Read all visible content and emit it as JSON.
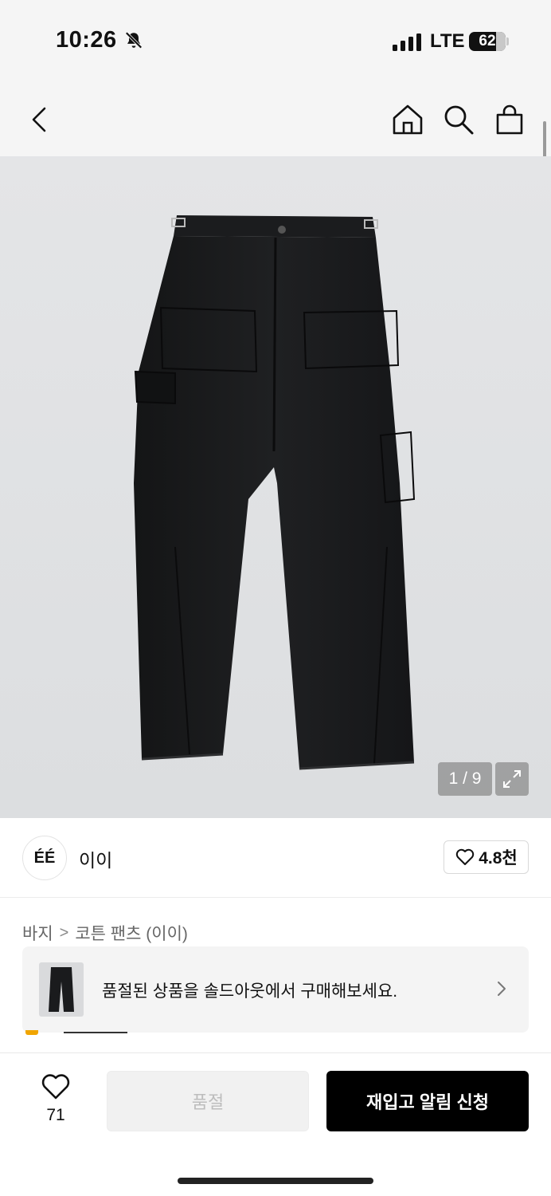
{
  "status": {
    "time": "10:26",
    "network": "LTE",
    "battery": "62",
    "icons": [
      "bell-muted-icon",
      "signal-icon",
      "battery-icon"
    ]
  },
  "nav": {
    "icons": [
      "back-chevron-icon",
      "home-icon",
      "search-icon",
      "shopping-bag-icon"
    ]
  },
  "gallery": {
    "counter": "1 / 9",
    "expand_icon": "expand-icon"
  },
  "brand": {
    "logo_text": "ÉÉ",
    "name": "이이",
    "likes": "4.8천"
  },
  "breadcrumb": {
    "category": "바지",
    "separator": ">",
    "product": "코튼 팬츠 (이이)"
  },
  "banner": {
    "text": "품절된 상품을 솔드아웃에서 구매해보세요."
  },
  "bottom": {
    "wish_count": "71",
    "soldout_label": "품절",
    "restock_label": "재입고 알림 신청"
  },
  "colors": {
    "accent": "#000000",
    "background": "#f5f5f5",
    "disabled_text": "#bdbdbd"
  }
}
